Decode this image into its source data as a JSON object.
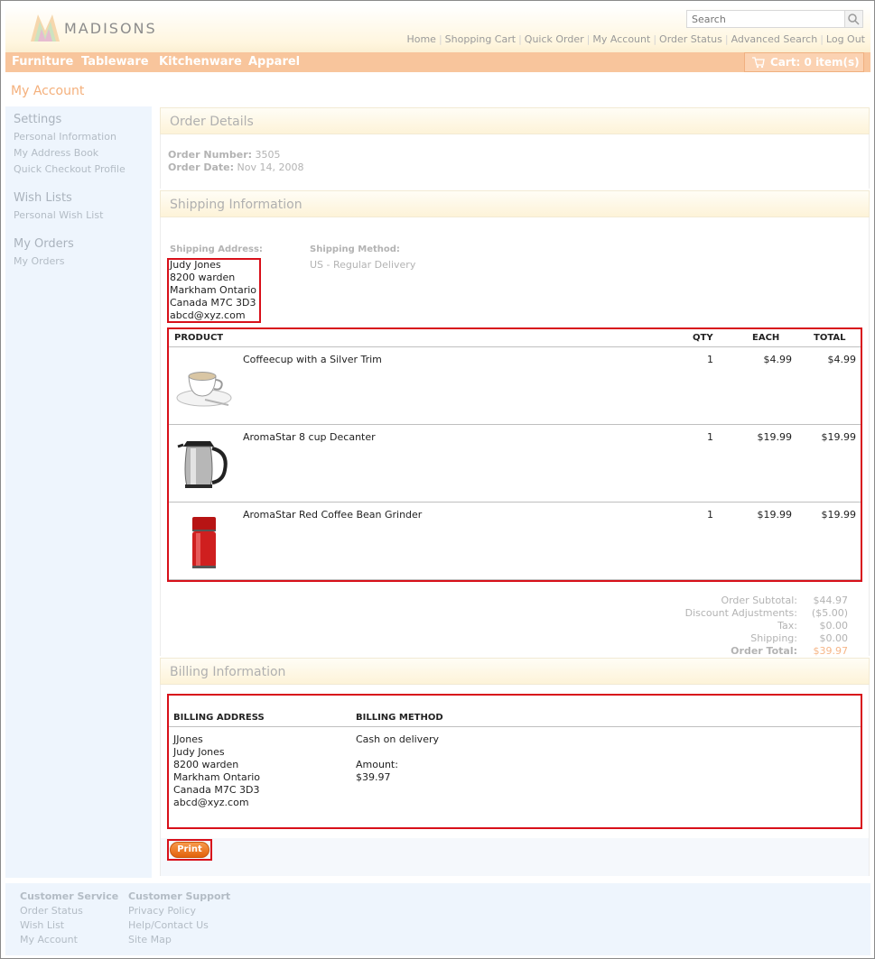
{
  "brand": {
    "name": "MADISONS"
  },
  "search": {
    "placeholder": "Search"
  },
  "toplinks": [
    "Home",
    "Shopping Cart",
    "Quick Order",
    "My Account",
    "Order Status",
    "Advanced Search",
    "Log Out"
  ],
  "nav": {
    "categories": [
      "Furniture",
      "Tableware",
      "Kitchenware",
      "Apparel"
    ],
    "cart_label": "Cart: 0 item(s)"
  },
  "page_title": "My Account",
  "sidebar": {
    "settings": {
      "heading": "Settings",
      "links": [
        "Personal Information",
        "My Address Book",
        "Quick Checkout Profile"
      ]
    },
    "wish": {
      "heading": "Wish Lists",
      "links": [
        "Personal Wish List"
      ]
    },
    "orders": {
      "heading": "My Orders",
      "links": [
        "My Orders"
      ]
    }
  },
  "order_details": {
    "title": "Order Details",
    "number_label": "Order Number:",
    "number": "3505",
    "date_label": "Order Date:",
    "date": "Nov 14, 2008"
  },
  "shipping": {
    "title": "Shipping Information",
    "address_label": "Shipping Address:",
    "address": [
      "Judy Jones",
      "8200 warden",
      "Markham Ontario",
      "Canada M7C 3D3",
      "abcd@xyz.com"
    ],
    "method_label": "Shipping Method:",
    "method": "US - Regular Delivery"
  },
  "products": {
    "headers": {
      "product": "PRODUCT",
      "qty": "QTY",
      "each": "EACH",
      "total": "TOTAL"
    },
    "rows": [
      {
        "name": "Coffeecup with a Silver Trim",
        "qty": "1",
        "each": "$4.99",
        "total": "$4.99",
        "icon": "coffee-cup"
      },
      {
        "name": "AromaStar 8 cup Decanter",
        "qty": "1",
        "each": "$19.99",
        "total": "$19.99",
        "icon": "decanter"
      },
      {
        "name": "AromaStar Red Coffee Bean Grinder",
        "qty": "1",
        "each": "$19.99",
        "total": "$19.99",
        "icon": "grinder"
      }
    ]
  },
  "totals": {
    "subtotal_label": "Order Subtotal:",
    "subtotal": "$44.97",
    "discount_label": "Discount Adjustments:",
    "discount": "($5.00)",
    "tax_label": "Tax:",
    "tax": "$0.00",
    "shipping_label": "Shipping:",
    "shipping": "$0.00",
    "total_label": "Order Total:",
    "total": "$39.97"
  },
  "billing": {
    "title": "Billing Information",
    "address_header": "BILLING ADDRESS",
    "method_header": "BILLING METHOD",
    "address": [
      "JJones",
      "Judy Jones",
      "8200 warden",
      "Markham Ontario",
      "Canada M7C 3D3",
      "abcd@xyz.com"
    ],
    "method": "Cash on delivery",
    "amount_label": "Amount:",
    "amount": "$39.97"
  },
  "print_label": "Print",
  "footer": {
    "customer_service": {
      "heading": "Customer Service",
      "links": [
        "Order Status",
        "Wish List",
        "My Account"
      ]
    },
    "customer_support": {
      "heading": "Customer Support",
      "links": [
        "Privacy Policy",
        "Help/Contact Us",
        "Site Map"
      ]
    }
  },
  "colors": {
    "accent": "#f8c59c",
    "title": "#f4b07c",
    "highlight_box": "#d8101a",
    "print_button": "#e2620b"
  }
}
